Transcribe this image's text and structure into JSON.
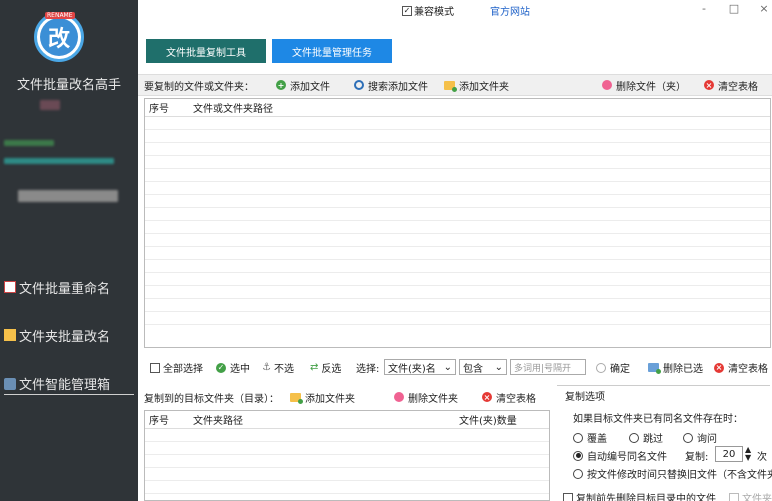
{
  "sidebar": {
    "logo_badge": "RENAME",
    "logo_glyph": "改",
    "app_name": "文件批量改名高手",
    "nav": [
      {
        "label": "文件批量重命名",
        "icon": "document-icon"
      },
      {
        "label": "文件夹批量改名",
        "icon": "folder-icon"
      },
      {
        "label": "文件智能管理箱",
        "icon": "toolbox-icon"
      }
    ]
  },
  "titlebar": {
    "compat_label": "兼容模式",
    "compat_checked": true,
    "official_site": "官方网站",
    "minimize": "-",
    "maximize": "□",
    "close": "×"
  },
  "tabs": [
    {
      "label": "文件批量复制工具"
    },
    {
      "label": "文件批量管理任务"
    }
  ],
  "files_toolbar": {
    "label": "要复制的文件或文件夹：",
    "add_file": "添加文件",
    "search_add": "搜索添加文件",
    "add_folder": "添加文件夹",
    "delete": "删除文件（夹）",
    "clear": "清空表格"
  },
  "files_table": {
    "columns": [
      "序号",
      "文件或文件夹路径"
    ]
  },
  "selection_bar": {
    "select_all": "全部选择",
    "select": "选中",
    "deselect": "不选",
    "invert": "反选",
    "choose_label": "选择:",
    "type_value": "文件(夹)名",
    "match_value": "包含",
    "keyword_placeholder": "多词用|号隔开",
    "confirm": "确定",
    "delete_selected": "删除已选",
    "clear": "清空表格"
  },
  "target_toolbar": {
    "label": "复制到的目标文件夹（目录）：",
    "add_folder": "添加文件夹",
    "delete_folder": "删除文件夹",
    "clear": "清空表格"
  },
  "target_table": {
    "columns": [
      "序号",
      "文件夹路径",
      "文件(夹)数量"
    ]
  },
  "copy_options": {
    "title": "复制选项",
    "question": "如果目标文件夹已有同名文件存在时：",
    "overwrite": "覆盖",
    "skip": "跳过",
    "ask": "询问",
    "auto_number": "自动编号同名文件",
    "copies_label": "复制:",
    "copies_value": "20",
    "copies_unit": "次",
    "replace_newer": "按文件修改时间只替换旧文件（不含文件夹）",
    "before_delete": "复制前先删除目标目录中的文件",
    "file_only": "文件夹"
  }
}
